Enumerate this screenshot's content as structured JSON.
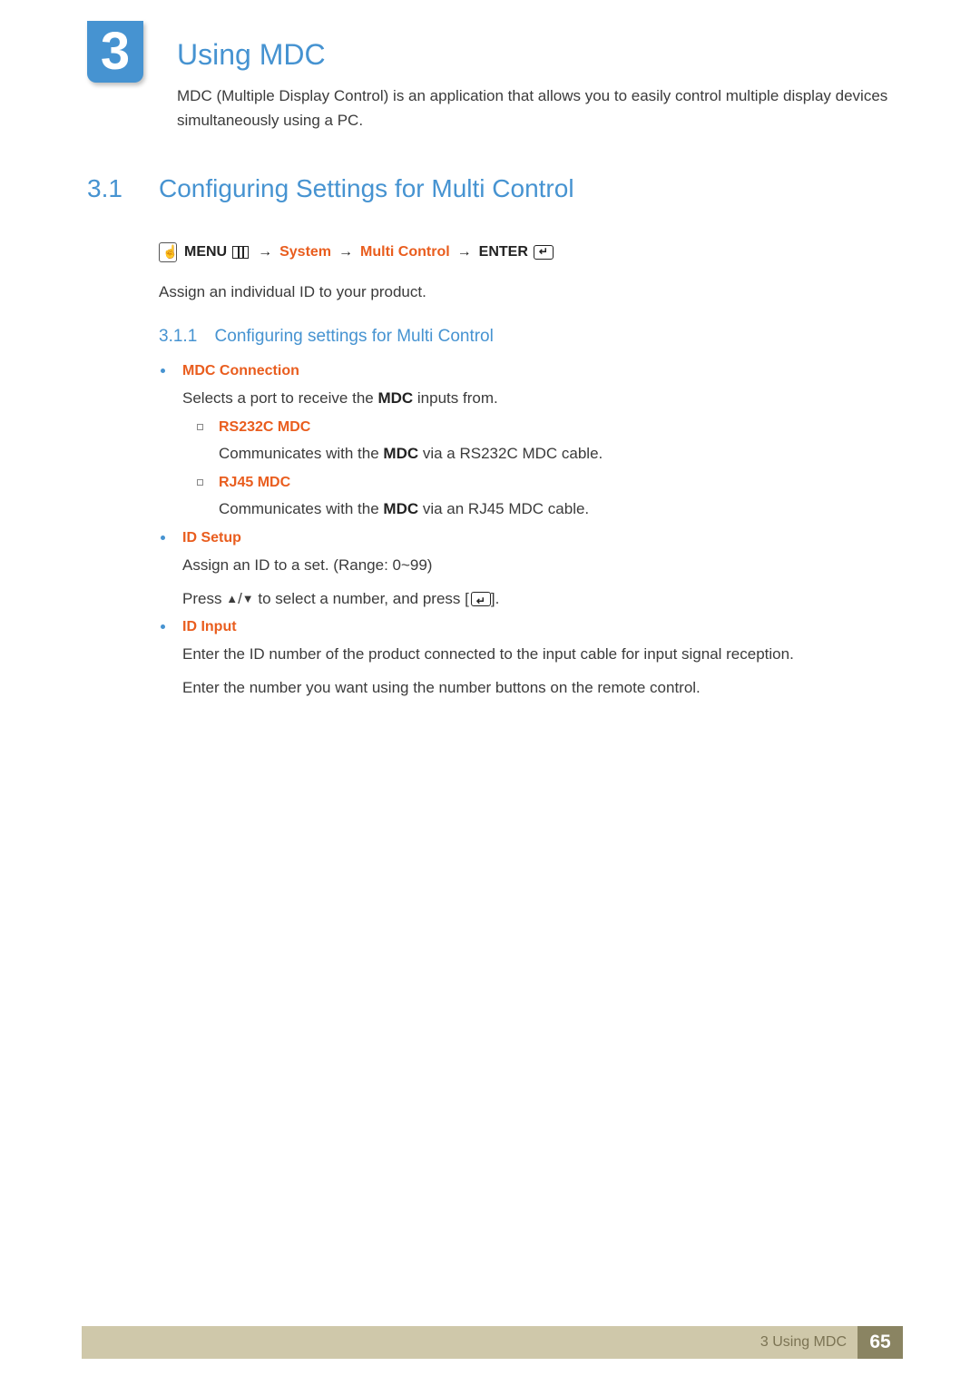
{
  "chapter": {
    "number": "3",
    "title": "Using MDC",
    "intro": "MDC (Multiple Display Control) is an application that allows you to easily control multiple display devices simultaneously using a PC."
  },
  "section": {
    "number": "3.1",
    "title": "Configuring Settings for Multi Control",
    "nav": {
      "menu": "MENU",
      "system": "System",
      "multi": "Multi Control",
      "enter": "ENTER",
      "arrow": "→"
    },
    "assign": "Assign an individual ID to your product."
  },
  "subsection": {
    "number": "3.1.1",
    "title": "Configuring settings for Multi Control"
  },
  "items": {
    "mdc_conn": {
      "title": "MDC Connection",
      "body_pre": "Selects a port to receive the ",
      "body_bold": "MDC",
      "body_post": " inputs from.",
      "rs232c": {
        "title": "RS232C MDC",
        "pre": "Communicates with the ",
        "bold": "MDC",
        "post": " via a RS232C MDC cable."
      },
      "rj45": {
        "title": "RJ45 MDC",
        "pre": "Communicates with the ",
        "bold": "MDC",
        "post": " via an RJ45 MDC cable."
      }
    },
    "id_setup": {
      "title": "ID Setup",
      "line1": "Assign an ID to a set. (Range: 0~99)",
      "press_pre": "Press ",
      "up": "▲",
      "slash": "/",
      "down": "▼",
      "press_mid": " to select a number, and press [",
      "press_post": "]."
    },
    "id_input": {
      "title": "ID Input",
      "line1": "Enter the ID number of the product connected to the input cable for input signal reception.",
      "line2": "Enter the number you want using the number buttons on the remote control."
    }
  },
  "footer": {
    "label": "3 Using MDC",
    "page": "65"
  }
}
